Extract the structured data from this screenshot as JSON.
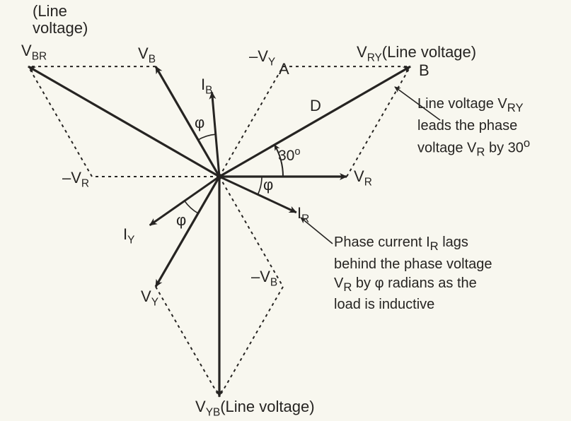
{
  "diagram": {
    "title": "Three-phase star phasor diagram",
    "labels": {
      "VBR_note": "(Line<br>voltage)",
      "VBR": "V<sub>BR</sub>",
      "VB": "V<sub>B</sub>",
      "negVY_A": "&ndash;V<sub>Y</sub>",
      "A": "A",
      "VRY": "V<sub>RY</sub>(Line voltage)",
      "B": "B",
      "IB": "I<sub>B</sub>",
      "D": "D",
      "angle30": "30<sup>o</sup>",
      "phi_top": "&phi;",
      "phi_right": "&phi;",
      "phi_left": "&phi;",
      "VR": "V<sub>R</sub>",
      "negVR": "&ndash;V<sub>R</sub>",
      "IR": "I<sub>R</sub>",
      "IY": "I<sub>Y</sub>",
      "VY": "V<sub>Y</sub>",
      "negVB": "&ndash;V<sub>B</sub>",
      "VYB": "V<sub>YB</sub>(Line voltage)"
    },
    "annotations": {
      "vry_note": "Line voltage V<sub>RY</sub><br>leads the phase<br>voltage V<sub>R</sub> by 30<sup>o</sup>",
      "ir_note": "Phase current I<sub>R</sub> lags<br>behind the phase voltage<br>V<sub>R</sub> by &phi; radians as the<br>load is inductive"
    }
  },
  "chart_data": {
    "type": "vector-phasor",
    "origin": [
      310,
      250
    ],
    "phase_voltage_length": 180,
    "line_voltage_length": 312,
    "current_length": 120,
    "phi_deg": 25,
    "vectors": [
      {
        "name": "V_R",
        "kind": "phase_voltage",
        "angle_deg": 0,
        "solid": true
      },
      {
        "name": "V_Y",
        "kind": "phase_voltage",
        "angle_deg": 240,
        "solid": true
      },
      {
        "name": "V_B",
        "kind": "phase_voltage",
        "angle_deg": 120,
        "solid": true
      },
      {
        "name": "-V_R",
        "kind": "phase_voltage",
        "angle_deg": 180,
        "solid": false,
        "dashed": true
      },
      {
        "name": "-V_Y",
        "kind": "phase_voltage",
        "angle_deg": 60,
        "solid": false,
        "dashed": true
      },
      {
        "name": "-V_B",
        "kind": "phase_voltage",
        "angle_deg": 300,
        "solid": false,
        "dashed": true
      },
      {
        "name": "V_RY",
        "kind": "line_voltage",
        "angle_deg": 30,
        "solid": true
      },
      {
        "name": "V_YB",
        "kind": "line_voltage",
        "angle_deg": 270,
        "solid": true
      },
      {
        "name": "V_BR",
        "kind": "line_voltage",
        "angle_deg": 150,
        "solid": true
      },
      {
        "name": "I_R",
        "kind": "current",
        "angle_deg": -25,
        "solid": true
      },
      {
        "name": "I_Y",
        "kind": "current",
        "angle_deg": 215,
        "solid": true
      },
      {
        "name": "I_B",
        "kind": "current",
        "angle_deg": 95,
        "solid": true
      }
    ],
    "constructions": [
      {
        "from": "V_R_tip",
        "to": "V_RY_tip",
        "dashed": true
      },
      {
        "from": "-V_Y_tip",
        "to": "V_RY_tip",
        "dashed": true
      },
      {
        "from": "V_B_tip",
        "to": "V_BR_tip",
        "dashed": true
      },
      {
        "from": "-V_R_tip",
        "to": "V_BR_tip",
        "dashed": true
      },
      {
        "from": "V_Y_tip",
        "to": "V_YB_tip",
        "dashed": true
      },
      {
        "from": "-V_B_tip",
        "to": "V_YB_tip",
        "dashed": true
      }
    ],
    "angle_marks": [
      {
        "between": [
          "V_R",
          "V_RY"
        ],
        "label": "30°"
      },
      {
        "between": [
          "V_R",
          "I_R"
        ],
        "label": "φ"
      },
      {
        "between": [
          "V_Y",
          "I_Y"
        ],
        "label": "φ"
      },
      {
        "between": [
          "V_B",
          "I_B"
        ],
        "label": "φ"
      }
    ]
  }
}
